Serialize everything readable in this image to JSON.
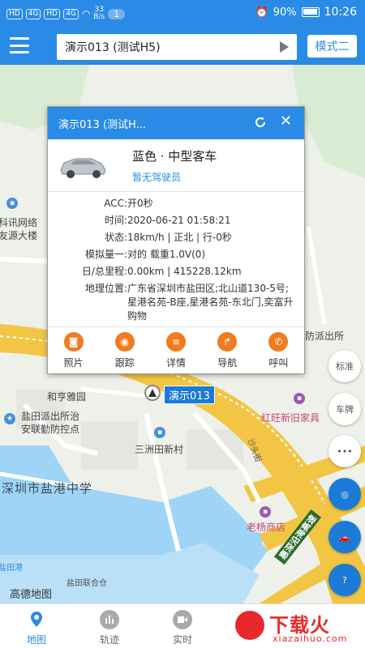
{
  "statusbar": {
    "net1": "HD",
    "net2": "HD",
    "sig1": "4G",
    "sig2": "4G",
    "speed_value": "33",
    "speed_unit": "B/s",
    "notif_count": "1",
    "battery": "90%",
    "time": "10:26"
  },
  "header": {
    "vehicle": "演示013 (测试H5)",
    "mode": "模式二"
  },
  "map": {
    "labels": {
      "xunwang": "科讯网络",
      "dasha": "友源大楼",
      "hetingyuan": "和亨雅园",
      "paichusuo1": "盐田派出所治",
      "paichusuo2": "安联勤防控点",
      "hongwang": "红旺新旧家具",
      "shatouxing": "沙头街",
      "sanzhoutian": "三洲田新村",
      "zhongxue": "深圳市盐港中学",
      "laoyang": "老杨商店",
      "highway": "惠深沿海高速",
      "paichusuo_r": "防派出所",
      "lianhecang": "盐田联合仓",
      "yantiangang": "盐田港",
      "gaode": "高德地图"
    },
    "vehicle_tag": "演示013",
    "fab_standard": "标准",
    "fab_plate": "车牌"
  },
  "popup": {
    "title": "演示013 (测试H...",
    "vehicle_type": "蓝色 · 中型客车",
    "driver": "暂无驾驶员",
    "rows": [
      {
        "k": "ACC:",
        "v": "开0秒"
      },
      {
        "k": "时间:",
        "v": "2020-06-21 01:58:21"
      },
      {
        "k": "状态:",
        "v": "18km/h | 正北 | 行-0秒"
      },
      {
        "k": "模拟量一:",
        "v": "对的 载重1.0V(0)"
      },
      {
        "k": "日/总里程:",
        "v": "0.00km | 415228.12km"
      },
      {
        "k": "地理位置:",
        "v": "广东省深圳市盐田区;北山道130-5号;星港名苑-B座,星港名苑-东北门,奕富升购物"
      }
    ],
    "actions": [
      "照片",
      "跟踪",
      "详情",
      "导航",
      "呼叫"
    ]
  },
  "tabs": [
    "地图",
    "轨迹",
    "实时"
  ],
  "watermark": {
    "top": "下载火",
    "bottom": "xiazaihuo.com"
  },
  "colors": {
    "primary": "#2a8be6",
    "accent": "#f07b20",
    "road": "#f3c545",
    "water": "#9ed4f5"
  }
}
